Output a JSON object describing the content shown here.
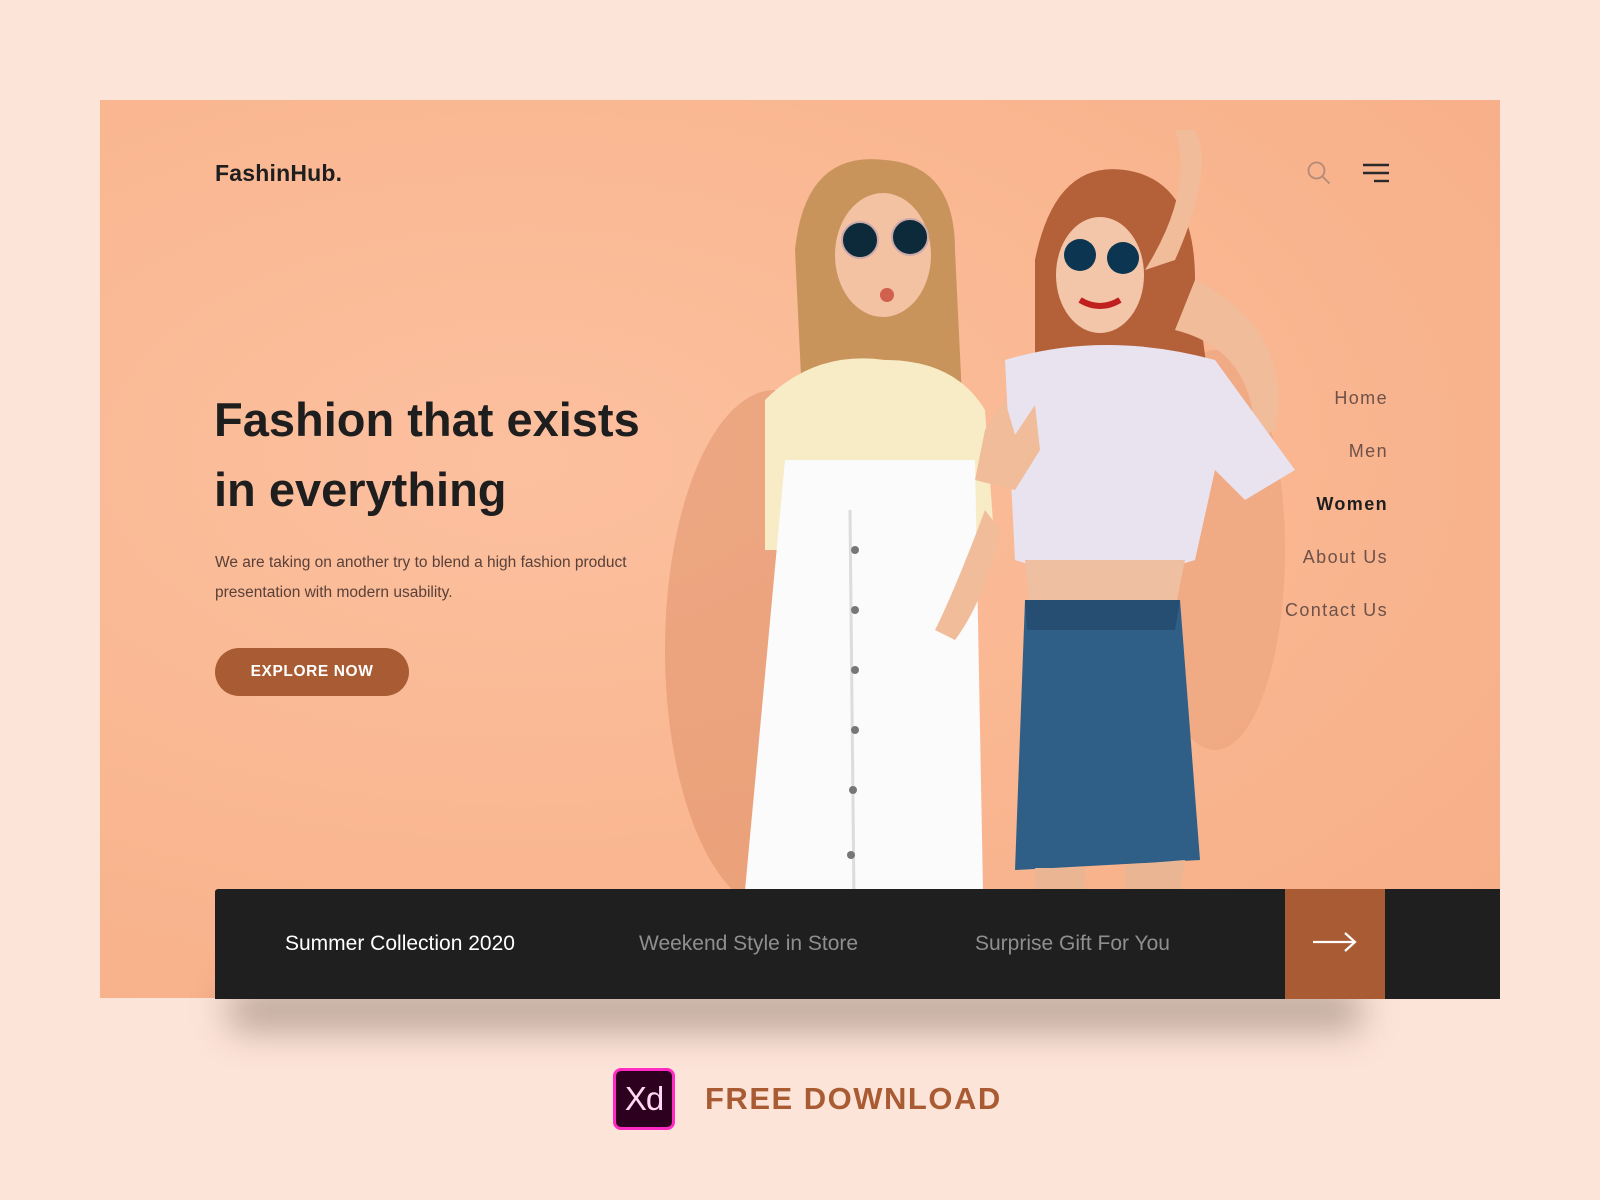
{
  "brand": {
    "logo": "FashinHub."
  },
  "header": {
    "icons": [
      "search-icon",
      "menu-icon"
    ]
  },
  "hero": {
    "headline_line1": "Fashion that exists",
    "headline_line2": "in everything",
    "subtext": "We are taking on another try to blend a high fashion product presentation with modern usability.",
    "cta_label": "EXPLORE NOW",
    "image_alt": "Two women in sunglasses posing against a peach wall"
  },
  "nav": {
    "items": [
      {
        "label": "Home",
        "active": false
      },
      {
        "label": "Men",
        "active": false
      },
      {
        "label": "Women",
        "active": true
      },
      {
        "label": "About Us",
        "active": false
      },
      {
        "label": "Contact Us",
        "active": false
      }
    ]
  },
  "promo": {
    "items": [
      {
        "label": "Summer Collection 2020",
        "active": true
      },
      {
        "label": "Weekend Style in Store",
        "active": false
      },
      {
        "label": "Surprise Gift For You",
        "active": false
      }
    ],
    "next_icon": "arrow-right-icon"
  },
  "footer": {
    "badge_text": "Xd",
    "download_label": "FREE DOWNLOAD"
  },
  "colors": {
    "page_bg": "#fde4d8",
    "hero_bg": "#f9b690",
    "accent": "#a95c33",
    "dark": "#1f1f1f",
    "xd_border": "#ff2bc2"
  }
}
